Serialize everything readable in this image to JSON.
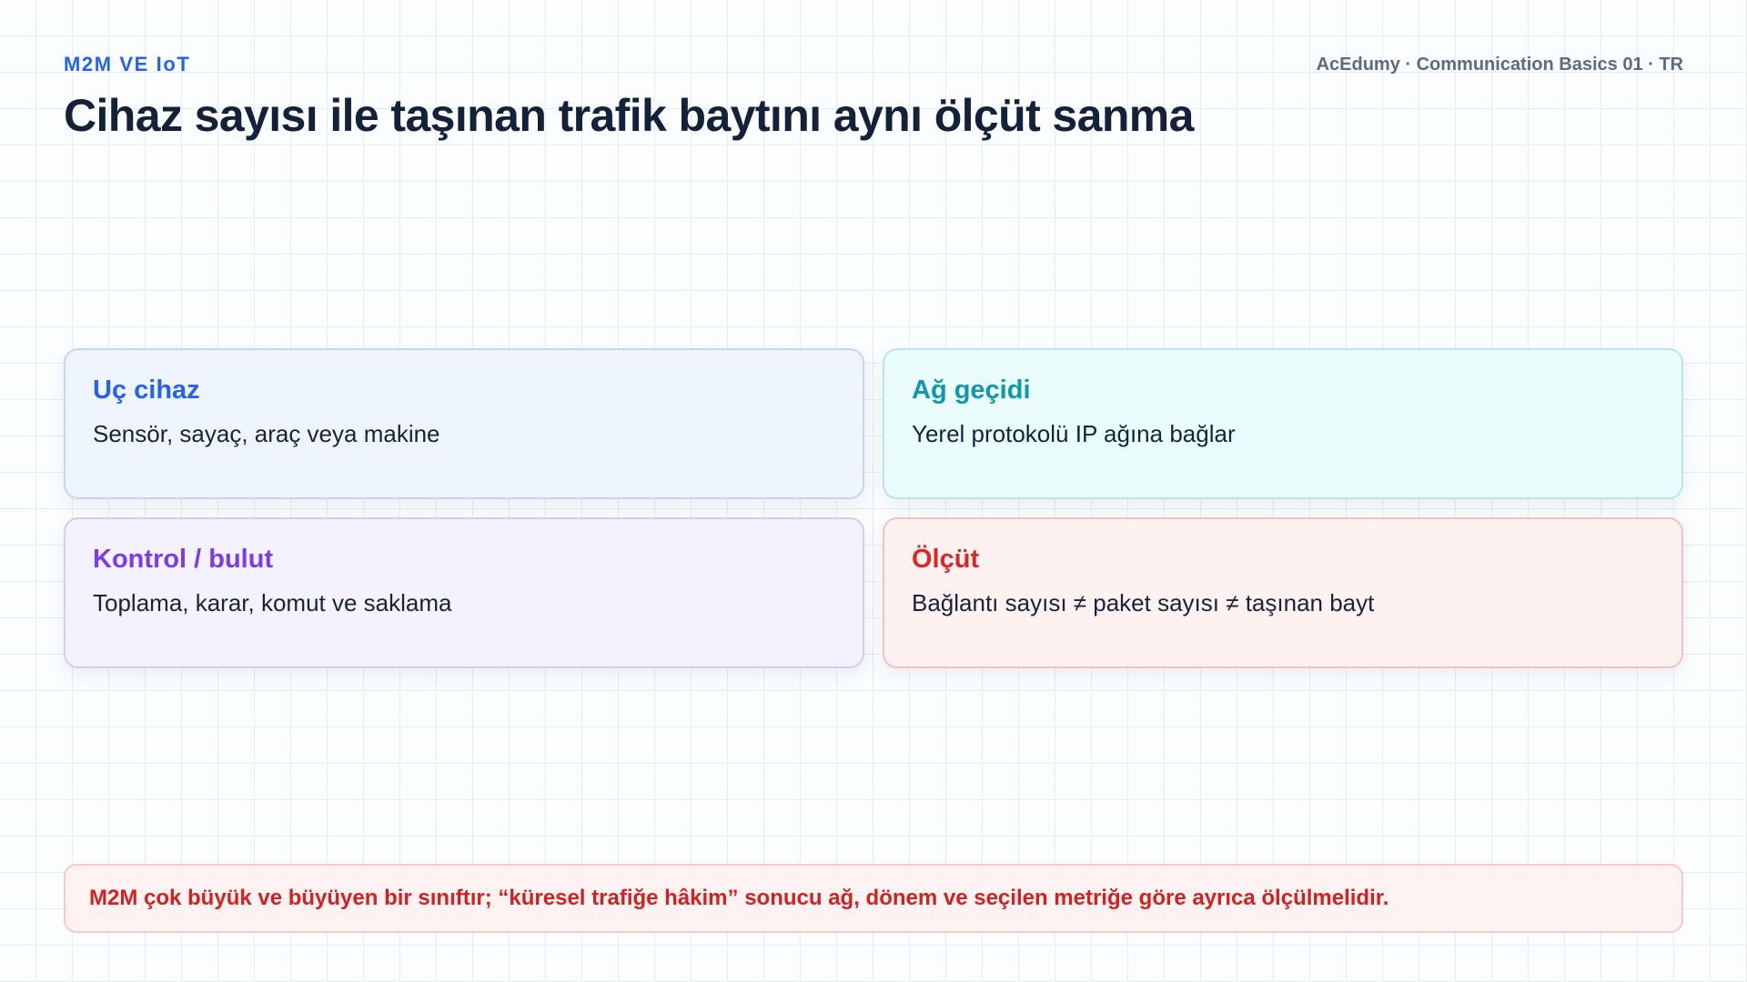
{
  "header": {
    "eyebrow": "M2M VE IoT",
    "meta": "AcEdumy · Communication Basics 01 · TR",
    "title": "Cihaz sayısı ile taşınan trafik baytını aynı ölçüt sanma"
  },
  "cards": [
    {
      "title": "Uç cihaz",
      "body": "Sensör, sayaç, araç veya makine",
      "accent": "#2563eb"
    },
    {
      "title": "Ağ geçidi",
      "body": "Yerel protokolü IP ağına bağlar",
      "accent": "#0e97ad"
    },
    {
      "title": "Kontrol / bulut",
      "body": "Toplama, karar, komut ve saklama",
      "accent": "#7c3aed"
    },
    {
      "title": "Ölçüt",
      "body": "Bağlantı sayısı ≠ paket sayısı ≠ taşınan bayt",
      "accent": "#dc2626"
    }
  ],
  "note": {
    "text": "M2M çok büyük ve büyüyen bir sınıftır; “küresel trafiğe hâkim” sonucu ağ, dönem ve seçilen metriğe göre ayrıca ölçülmelidir.",
    "color": "#d32020"
  }
}
